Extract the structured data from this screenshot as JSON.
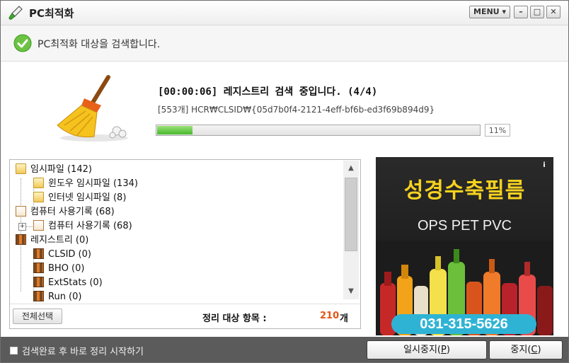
{
  "window": {
    "title": "PC최적화"
  },
  "titlebar": {
    "menu_label": "MENU ▾",
    "min_glyph": "–",
    "max_glyph": "□",
    "close_glyph": "✕"
  },
  "status": {
    "message": "PC최적화 대상을 검색합니다."
  },
  "progress": {
    "title": "[00:00:06] 레지스트리 검색 중입니다. (4/4)",
    "path": "[553개] HCR₩CLSID₩{05d7b0f4-2121-4eff-bf6b-ed3f69b894d9}",
    "value": 0.11,
    "percent_label": "11%"
  },
  "tree": {
    "items": [
      {
        "label": "임시파일 (142)",
        "icon": "folder-icon"
      },
      {
        "label": "윈도우 임시파일 (134)",
        "icon": "folder-icon"
      },
      {
        "label": "인터넷 임시파일 (8)",
        "icon": "folder-icon"
      },
      {
        "label": "컴퓨터 사용기록 (68)",
        "icon": "history-icon"
      },
      {
        "label": "컴퓨터 사용기록 (68)",
        "icon": "history-icon"
      },
      {
        "label": "레지스트리 (0)",
        "icon": "registry-icon"
      },
      {
        "label": "CLSID (0)",
        "icon": "registry-icon"
      },
      {
        "label": "BHO (0)",
        "icon": "registry-icon"
      },
      {
        "label": "ExtStats (0)",
        "icon": "registry-icon"
      },
      {
        "label": "Run (0)",
        "icon": "registry-icon"
      }
    ],
    "expander_glyph": "+",
    "scroll_up_glyph": "▲",
    "scroll_down_glyph": "▼"
  },
  "footer": {
    "select_all": "전체선택",
    "count_label": "정리 대상 항목 :",
    "count_value": "210",
    "count_unit": "개"
  },
  "ad": {
    "info_glyph": "i",
    "title": "성경수축필름",
    "subtitle": "OPS PET PVC",
    "phone": "031-315-5626"
  },
  "bottom": {
    "auto_clean_label": "검색완료 후 바로 정리 시작하기",
    "pause_text": "일시중지(",
    "pause_key": "P",
    "pause_close": ")",
    "stop_text": "중지(",
    "stop_key": "C",
    "stop_close": ")"
  },
  "colors": {
    "accent_green": "#47b82c",
    "count_orange": "#e25515",
    "ad_yellow": "#f7d21f",
    "ad_cyan": "#2fb3d4"
  }
}
